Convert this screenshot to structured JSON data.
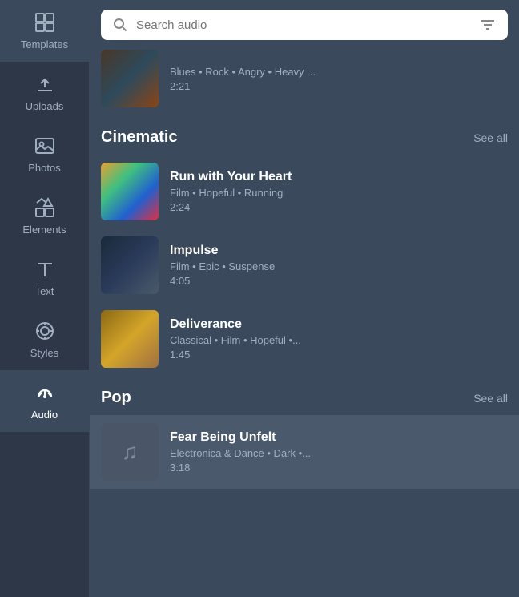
{
  "sidebar": {
    "items": [
      {
        "id": "templates",
        "label": "Templates",
        "active": false
      },
      {
        "id": "uploads",
        "label": "Uploads",
        "active": false
      },
      {
        "id": "photos",
        "label": "Photos",
        "active": false
      },
      {
        "id": "elements",
        "label": "Elements",
        "active": false
      },
      {
        "id": "text",
        "label": "Text",
        "active": false
      },
      {
        "id": "styles",
        "label": "Styles",
        "active": false
      },
      {
        "id": "audio",
        "label": "Audio",
        "active": true
      }
    ]
  },
  "search": {
    "placeholder": "Search audio",
    "value": ""
  },
  "sections": [
    {
      "id": "cinematic",
      "title": "Cinematic",
      "see_all": "See all",
      "items": [
        {
          "id": "run-with-your-heart",
          "title": "Run with Your Heart",
          "tags": "Film • Hopeful • Running",
          "duration": "2:24",
          "art": "cinematic1"
        },
        {
          "id": "impulse",
          "title": "Impulse",
          "tags": "Film • Epic • Suspense",
          "duration": "4:05",
          "art": "cinematic2"
        },
        {
          "id": "deliverance",
          "title": "Deliverance",
          "tags": "Classical • Film • Hopeful •...",
          "duration": "1:45",
          "art": "cinematic3"
        }
      ]
    },
    {
      "id": "pop",
      "title": "Pop",
      "see_all": "See all",
      "items": [
        {
          "id": "fear-being-unfelt",
          "title": "Fear Being Unfelt",
          "tags": "Electronica & Dance • Dark •...",
          "duration": "3:18",
          "art": "pop1",
          "active": true
        }
      ]
    }
  ],
  "partial_top": {
    "tags": "Blues • Rock • Angry • Heavy ...",
    "duration": "2:21",
    "art": "blues"
  }
}
